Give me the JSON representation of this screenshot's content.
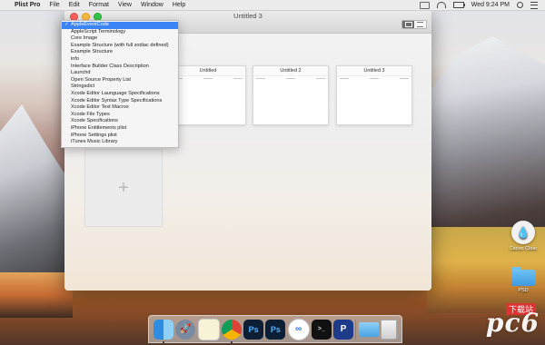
{
  "menubar": {
    "app_name": "Plist Pro",
    "menus": [
      "File",
      "Edit",
      "Format",
      "View",
      "Window",
      "Help"
    ],
    "clock": "Wed 9:24 PM"
  },
  "window": {
    "title": "Untitled 3"
  },
  "dropdown": {
    "items": [
      "AppleEventCode",
      "AppleScript Terminology",
      "Core Image",
      "Example Structure (with full zodiac defined)",
      "Example Structure",
      "info",
      "Interface Builder Class Description",
      "Launchd",
      "Open Source Property List",
      "Stringsdict",
      "Xcode Editor Launguage Specifications",
      "Xcode Editor Syntax Type Specifications",
      "Xcode Editor Text Macros",
      "Xcode File Types",
      "Xcode Specifications",
      "iPhone Entitlements plist",
      "iPhone Settings plist",
      "iTunes Music Library"
    ],
    "selected_index": 0
  },
  "documents": [
    {
      "title": "Untitled"
    },
    {
      "title": "Untitled 2"
    },
    {
      "title": "Untitled 3"
    }
  ],
  "add_tile": {
    "glyph": "+"
  },
  "desktop": {
    "icons": [
      {
        "label": "Cacoo Clear"
      },
      {
        "label": "PSD"
      }
    ]
  },
  "dock": {
    "apps": [
      {
        "name": "finder-icon",
        "glyph": ""
      },
      {
        "name": "launchpad-icon",
        "glyph": "🚀"
      },
      {
        "name": "notes-icon",
        "glyph": ""
      },
      {
        "name": "chrome-icon",
        "glyph": ""
      },
      {
        "name": "photoshop-icon",
        "glyph": "Ps"
      },
      {
        "name": "photoshop-alt-icon",
        "glyph": "Ps"
      },
      {
        "name": "baidu-netdisk-icon",
        "glyph": "∞"
      },
      {
        "name": "terminal-icon",
        "glyph": ">_"
      },
      {
        "name": "plist-pro-icon",
        "glyph": "P"
      }
    ]
  },
  "watermark": {
    "text": "pc6",
    "sub": "下载站"
  }
}
